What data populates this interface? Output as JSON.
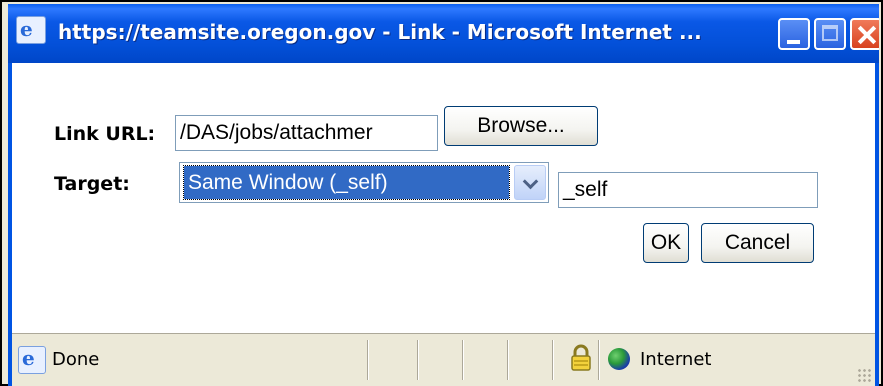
{
  "window": {
    "title": "https://teamsite.oregon.gov - Link - Microsoft Internet ...",
    "title_icon": "ie-icon",
    "controls": [
      "minimize",
      "maximize",
      "close"
    ]
  },
  "form": {
    "link_url_label": "Link URL:",
    "link_url_value": "/DAS/jobs/attachmer",
    "browse_label": "Browse...",
    "target_label": "Target:",
    "target_select_value": "Same Window (_self)",
    "target_text_value": "_self",
    "ok_label": "OK",
    "cancel_label": "Cancel"
  },
  "status": {
    "text": "Done",
    "zone": "Internet",
    "icons": [
      "ie-page-icon",
      "lock-icon",
      "globe-icon"
    ]
  },
  "colors": {
    "titlebar": "#0054e3",
    "selection": "#316ac5",
    "close_button": "#d8421e"
  }
}
